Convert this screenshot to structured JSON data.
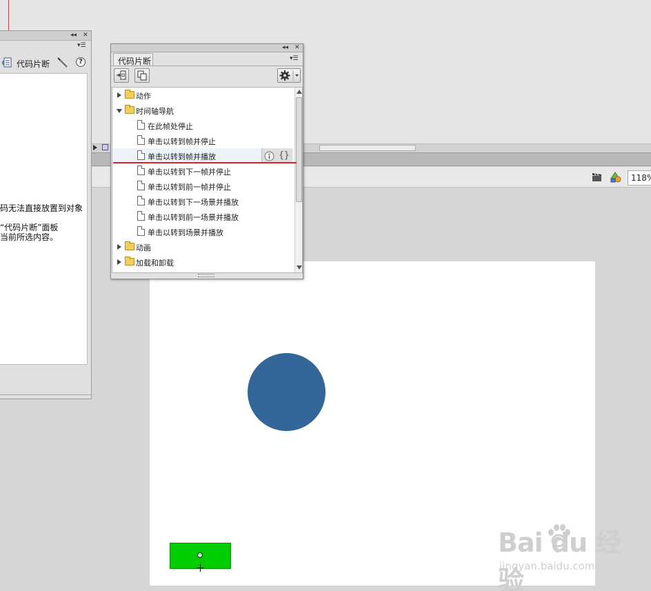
{
  "left_panel": {
    "tab_label": "代码片断",
    "messages": [
      "码无法直接放置到对象",
      "“代码片断”面板",
      "当前所选内容。"
    ],
    "icons": {
      "script": "script-icon",
      "wand": "wand-icon",
      "help": "help-icon"
    }
  },
  "snippets_panel": {
    "tab_label": "代码片断",
    "folders": {
      "actions": "动作",
      "timeline_nav": "时间轴导航",
      "animation": "动画",
      "load_unload": "加载和卸载"
    },
    "timeline_items": [
      "在此帧处停止",
      "单击以转到帧并停止",
      "单击以转到帧并播放",
      "单击以转到下一帧并停止",
      "单击以转到前一帧并停止",
      "单击以转到下一场景并播放",
      "单击以转到前一场景并播放",
      "单击以转到场景并播放"
    ],
    "icons": {
      "add": "add-to-actions-icon",
      "copy": "copy-icon",
      "options": "gear-icon",
      "info": "info-icon",
      "code": "braces-icon"
    }
  },
  "edit_bar": {
    "zoom": "118%"
  },
  "stage": {
    "circle_color": "#336699",
    "button_color": "#00cc00",
    "background": "#ffffff"
  },
  "watermark": {
    "logo": "Bai  du 经验",
    "url": "jingyan.baidu.com"
  }
}
